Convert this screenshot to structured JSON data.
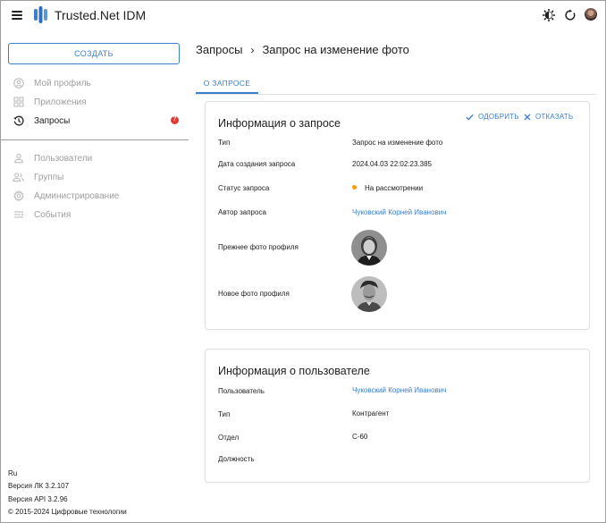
{
  "app": {
    "title": "Trusted.Net IDM",
    "colors": {
      "accent": "#3b7fd1",
      "badge": "#e53935",
      "status_pending": "#ff9800"
    },
    "icons": {
      "menu": "menu-icon",
      "logo": "trustednet-logo-icon",
      "theme": "theme-toggle-icon",
      "refresh": "refresh-icon",
      "avatar": "user-avatar"
    }
  },
  "sidebar": {
    "create_label": "СОЗДАТЬ",
    "items": [
      {
        "label": "Мой профиль",
        "icon": "profile-icon"
      },
      {
        "label": "Приложения",
        "icon": "apps-icon"
      },
      {
        "label": "Запросы",
        "icon": "history-icon",
        "badge": "7",
        "active": true
      },
      {
        "label": "Пользователи",
        "icon": "user-icon"
      },
      {
        "label": "Группы",
        "icon": "group-icon"
      },
      {
        "label": "Администрирование",
        "icon": "settings-icon"
      },
      {
        "label": "События",
        "icon": "events-icon"
      }
    ],
    "footer": {
      "lang": "Ru",
      "lk_version": "Версия ЛК 3.2.107",
      "api_version": "Версия API 3.2.96",
      "copyright": "© 2015-2024 Цифровые технологии"
    }
  },
  "breadcrumb": {
    "parent": "Запросы",
    "separator": "›",
    "current": "Запрос на изменение фото"
  },
  "tabs": [
    {
      "label": "О ЗАПРОСЕ",
      "active": true
    }
  ],
  "request_card": {
    "title": "Информация о запросе",
    "approve_label": "ОДОБРИТЬ",
    "reject_label": "ОТКАЗАТЬ",
    "rows": {
      "type": {
        "label": "Тип",
        "value": "Запрос на изменение фото"
      },
      "created": {
        "label": "Дата создания запроса",
        "value": "2024.04.03 22:02:23.385"
      },
      "status": {
        "label": "Статус запроса",
        "value": "На рассмотрении"
      },
      "author": {
        "label": "Автор запроса",
        "value": "Чуковский Корней Иванович"
      },
      "old_photo": {
        "label": "Прежнее фото профиля"
      },
      "new_photo": {
        "label": "Новое фото профиля"
      }
    }
  },
  "user_card": {
    "title": "Информация о пользователе",
    "rows": {
      "user": {
        "label": "Пользователь",
        "value": "Чуковский Корней Иванович"
      },
      "type": {
        "label": "Тип",
        "value": "Контрагент"
      },
      "department": {
        "label": "Отдел",
        "value": "С-60"
      },
      "position": {
        "label": "Должность",
        "value": ""
      }
    }
  }
}
